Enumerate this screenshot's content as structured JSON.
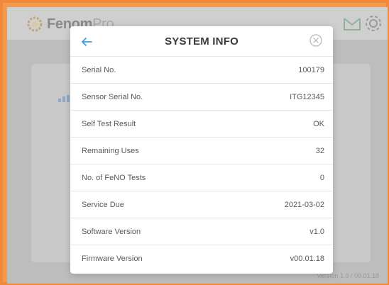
{
  "app": {
    "logo_name": "FenomPro",
    "logo_visible_bold": "Fe",
    "logo_visible_rest": "nom",
    "logo_pro": "Pro",
    "version_footer": "Version 1.0 / 00.01.18"
  },
  "modal": {
    "title": "SYSTEM INFO",
    "rows": [
      {
        "label": "Serial No.",
        "value": "100179"
      },
      {
        "label": "Sensor Serial No.",
        "value": "ITG12345"
      },
      {
        "label": "Self Test Result",
        "value": "OK"
      },
      {
        "label": "Remaining Uses",
        "value": "32"
      },
      {
        "label": "No. of FeNO Tests",
        "value": "0"
      },
      {
        "label": "Service Due",
        "value": "2021-03-02"
      },
      {
        "label": "Software Version",
        "value": "v1.0"
      },
      {
        "label": "Firmware Version",
        "value": "v00.01.18"
      }
    ]
  },
  "icons": {
    "back": "arrow-left-icon",
    "close": "close-circle-icon",
    "inbox": "inbox-check-icon",
    "settings": "gear-icon"
  },
  "colors": {
    "frame": "#f08a3a",
    "accent": "#3aa0e0",
    "overlay": "#bdbdbd"
  }
}
